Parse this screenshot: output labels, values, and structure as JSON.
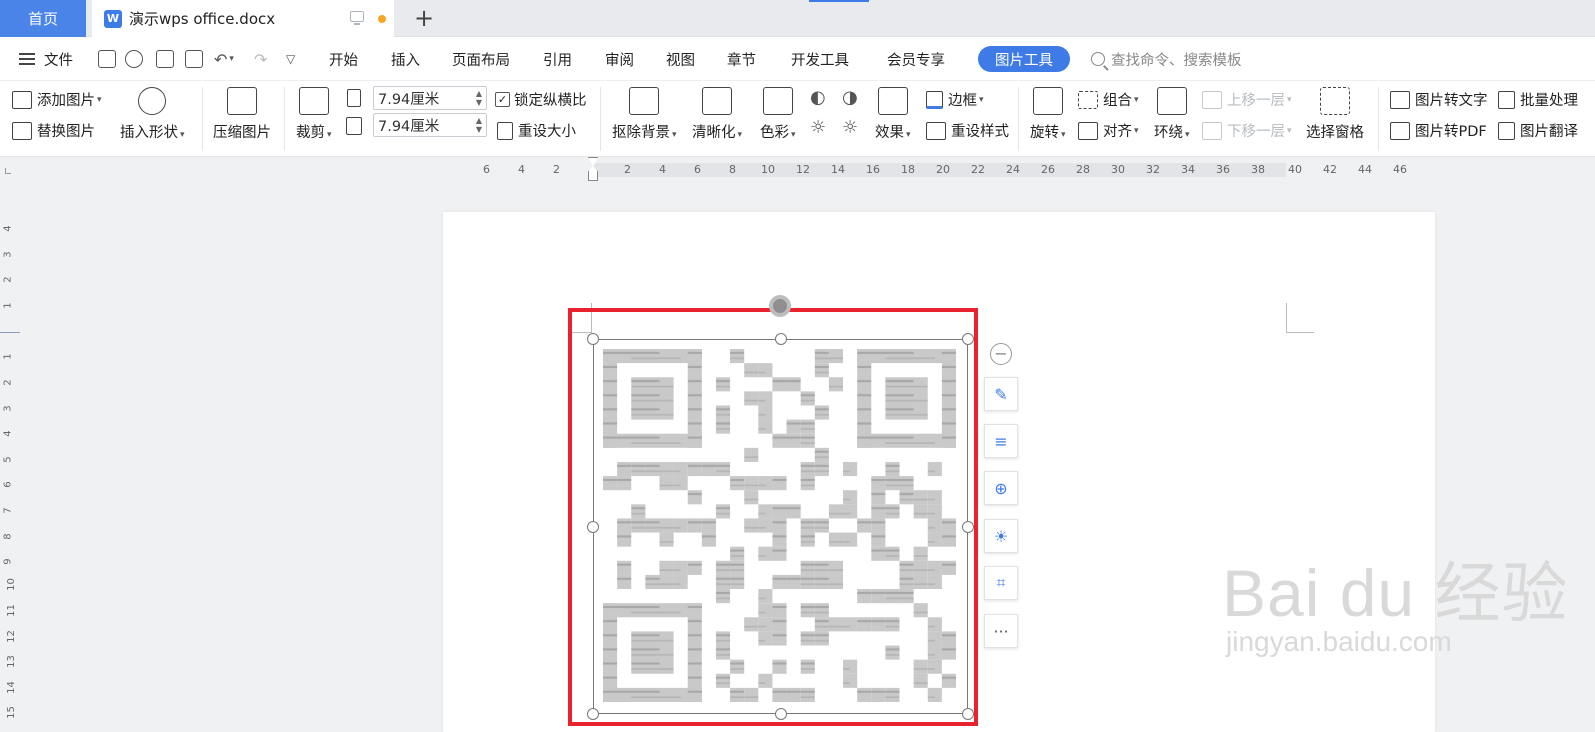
{
  "tabs": {
    "home": "首页",
    "doc_icon": "W",
    "doc_title": "演示wps office.docx",
    "new_tab": "+"
  },
  "menubar": {
    "file": "文件",
    "items": [
      "开始",
      "插入",
      "页面布局",
      "引用",
      "审阅",
      "视图",
      "章节",
      "开发工具",
      "会员专享"
    ],
    "picture_tools": "图片工具",
    "search_placeholder": "查找命令、搜索模板"
  },
  "ribbon": {
    "add_picture": "添加图片",
    "replace_picture": "替换图片",
    "insert_shape": "插入形状",
    "compress_picture": "压缩图片",
    "crop": "裁剪",
    "width_value": "7.94厘米",
    "height_value": "7.94厘米",
    "lock_ratio": "锁定纵横比",
    "lock_ratio_checked": true,
    "reset_size": "重设大小",
    "remove_background": "抠除背景",
    "sharpen": "清晰化",
    "color": "色彩",
    "effects": "效果",
    "border": "边框",
    "reset_style": "重设样式",
    "rotate": "旋转",
    "group": "组合",
    "align": "对齐",
    "wrap": "环绕",
    "bring_forward": "上移一层",
    "send_backward": "下移一层",
    "selection_pane": "选择窗格",
    "pic_to_text": "图片转文字",
    "batch_process": "批量处理",
    "pic_to_pdf": "图片转PDF",
    "pic_translate": "图片翻译"
  },
  "ruler": {
    "h_left": [
      "6",
      "4",
      "2"
    ],
    "h_right": [
      "2",
      "4",
      "6",
      "8",
      "10",
      "12",
      "14",
      "16",
      "18",
      "20",
      "22",
      "24",
      "26",
      "28",
      "30",
      "32",
      "34",
      "36",
      "38",
      "40",
      "42",
      "44",
      "46"
    ],
    "v_top": [
      "4",
      "3",
      "2",
      "1"
    ],
    "v_bottom": [
      "1",
      "2",
      "3",
      "4",
      "5",
      "6",
      "7",
      "8",
      "9",
      "10",
      "11",
      "12",
      "13",
      "14",
      "15"
    ]
  },
  "side_tools": [
    "edit-icon",
    "wrap-text-icon",
    "zoom-in-icon",
    "idea-icon",
    "crop-icon",
    "more-icon"
  ],
  "side_more": "···",
  "watermark": {
    "line1": "Bai du 经验",
    "line2": "jingyan.baidu.com"
  },
  "colors": {
    "accent": "#3f7be6",
    "selection_highlight": "#e8232e",
    "unsaved_dot": "#f5a623"
  }
}
